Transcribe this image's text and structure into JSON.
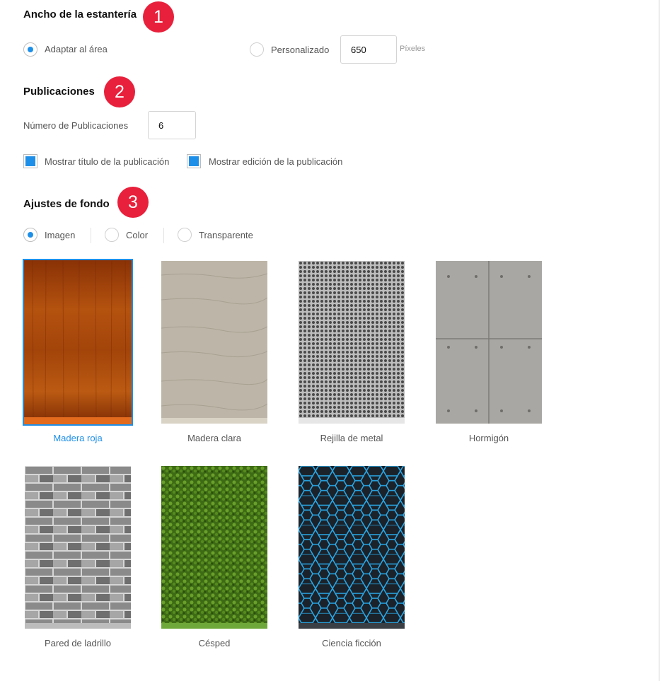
{
  "shelf_width": {
    "title": "Ancho de la estantería",
    "badge": "1",
    "options": [
      {
        "label": "Adaptar al área",
        "selected": true
      },
      {
        "label": "Personalizado",
        "selected": false
      }
    ],
    "custom_value": "650",
    "unit": "Píxeles"
  },
  "publications": {
    "title": "Publicaciones",
    "badge": "2",
    "count_label": "Número de Publicaciones",
    "count_value": "6",
    "checkboxes": [
      {
        "label": "Mostrar título de la publicación",
        "checked": true
      },
      {
        "label": "Mostrar edición de la publicación",
        "checked": true
      }
    ]
  },
  "background": {
    "title": "Ajustes de fondo",
    "badge": "3",
    "modes": [
      {
        "label": "Imagen",
        "selected": true
      },
      {
        "label": "Color",
        "selected": false
      },
      {
        "label": "Transparente",
        "selected": false
      }
    ],
    "textures": [
      {
        "label": "Madera roja",
        "selected": true
      },
      {
        "label": "Madera clara",
        "selected": false
      },
      {
        "label": "Rejilla de metal",
        "selected": false
      },
      {
        "label": "Hormigón",
        "selected": false
      },
      {
        "label": "Pared de ladrillo",
        "selected": false
      },
      {
        "label": "Césped",
        "selected": false
      },
      {
        "label": "Ciencia ficción",
        "selected": false
      }
    ]
  },
  "colors": {
    "accent": "#1e8fe8",
    "badge": "#e8203b"
  }
}
